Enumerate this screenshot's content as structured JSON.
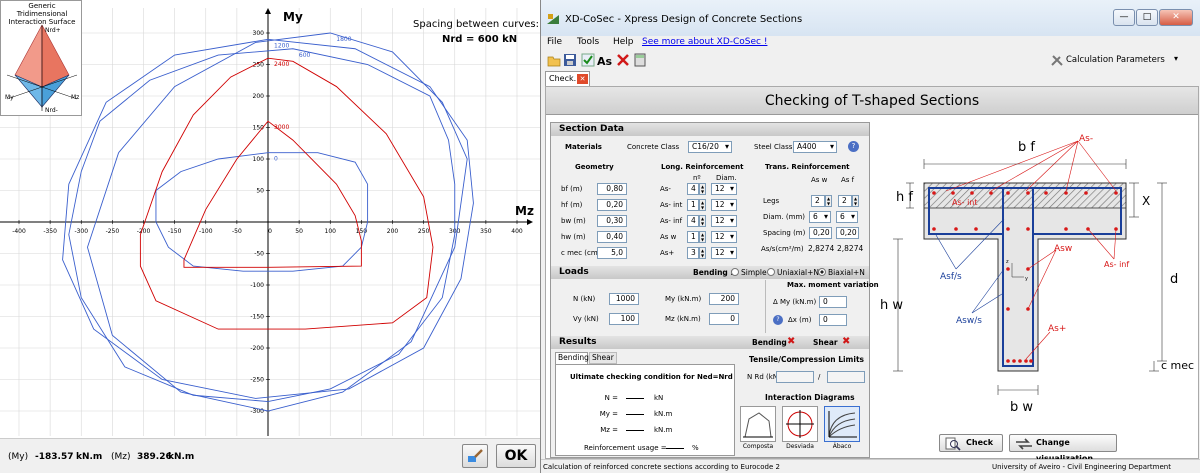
{
  "left_panel": {
    "thumbnail": {
      "title_line1": "Generic Tridimensional",
      "title_line2": "Interaction Surface",
      "top_label": "Nrd+",
      "bottom_label": "Nrd-",
      "my": "My",
      "mz": "Mz"
    },
    "spacing_label": "Spacing between curves:",
    "spacing_value": "Nrd = 600 kN",
    "chart_data": {
      "type": "line",
      "xlabel": "Mz",
      "ylabel": "My",
      "xlim": [
        -420,
        420
      ],
      "ylim": [
        -330,
        320
      ],
      "x_ticks": [
        -400,
        -350,
        -300,
        -250,
        -200,
        -150,
        -100,
        -50,
        0,
        50,
        100,
        150,
        200,
        250,
        300,
        350,
        400
      ],
      "y_ticks": [
        300,
        250,
        200,
        150,
        100,
        50,
        -50,
        -100,
        -150,
        -200,
        -250,
        -300
      ],
      "series": [
        {
          "name": "0",
          "color": "#3a5fcd",
          "points": [
            [
              -180,
              50
            ],
            [
              -140,
              80
            ],
            [
              -80,
              100
            ],
            [
              0,
              110
            ],
            [
              80,
              110
            ],
            [
              140,
              95
            ],
            [
              160,
              60
            ],
            [
              160,
              0
            ],
            [
              150,
              -40
            ],
            [
              120,
              -70
            ],
            [
              40,
              -78
            ],
            [
              -40,
              -78
            ],
            [
              -120,
              -70
            ],
            [
              -160,
              -40
            ],
            [
              -180,
              0
            ],
            [
              -180,
              50
            ]
          ]
        },
        {
          "name": "600",
          "color": "#3a5fcd",
          "points": [
            [
              -300,
              80
            ],
            [
              -270,
              160
            ],
            [
              -190,
              225
            ],
            [
              -80,
              265
            ],
            [
              40,
              275
            ],
            [
              160,
              250
            ],
            [
              260,
              200
            ],
            [
              290,
              130
            ],
            [
              300,
              60
            ],
            [
              300,
              -20
            ],
            [
              280,
              -120
            ],
            [
              210,
              -210
            ],
            [
              100,
              -265
            ],
            [
              0,
              -285
            ],
            [
              -120,
              -275
            ],
            [
              -230,
              -230
            ],
            [
              -300,
              -120
            ],
            [
              -320,
              -20
            ],
            [
              -300,
              80
            ]
          ]
        },
        {
          "name": "1200",
          "color": "#3a5fcd",
          "points": [
            [
              -320,
              60
            ],
            [
              -260,
              190
            ],
            [
              -150,
              265
            ],
            [
              0,
              290
            ],
            [
              140,
              275
            ],
            [
              260,
              215
            ],
            [
              320,
              130
            ],
            [
              330,
              30
            ],
            [
              310,
              -90
            ],
            [
              250,
              -200
            ],
            [
              130,
              -265
            ],
            [
              -20,
              -280
            ],
            [
              -170,
              -250
            ],
            [
              -280,
              -170
            ],
            [
              -330,
              -60
            ],
            [
              -320,
              60
            ]
          ]
        },
        {
          "name": "1800",
          "color": "#3a5fcd",
          "points": [
            [
              -240,
              110
            ],
            [
              -150,
              215
            ],
            [
              -20,
              285
            ],
            [
              100,
              300
            ],
            [
              200,
              270
            ],
            [
              280,
              190
            ],
            [
              320,
              100
            ],
            [
              300,
              -40
            ],
            [
              230,
              -190
            ],
            [
              120,
              -270
            ],
            [
              0,
              -300
            ],
            [
              -140,
              -270
            ],
            [
              -250,
              -180
            ],
            [
              -290,
              -40
            ],
            [
              -240,
              110
            ]
          ]
        },
        {
          "name": "2400",
          "color": "#d00000",
          "points": [
            [
              -205,
              -20
            ],
            [
              -170,
              80
            ],
            [
              -120,
              170
            ],
            [
              -60,
              230
            ],
            [
              0,
              260
            ],
            [
              40,
              255
            ],
            [
              110,
              215
            ],
            [
              190,
              140
            ],
            [
              250,
              40
            ],
            [
              265,
              -40
            ],
            [
              255,
              -120
            ],
            [
              200,
              -160
            ],
            [
              60,
              -170
            ],
            [
              -80,
              -170
            ],
            [
              -180,
              -125
            ],
            [
              -205,
              -70
            ],
            [
              -205,
              -20
            ]
          ]
        },
        {
          "name": "3000",
          "color": "#d00000",
          "points": [
            [
              -135,
              -60
            ],
            [
              -100,
              20
            ],
            [
              -50,
              100
            ],
            [
              0,
              160
            ],
            [
              40,
              130
            ],
            [
              110,
              60
            ],
            [
              140,
              10
            ],
            [
              150,
              -30
            ],
            [
              150,
              -70
            ],
            [
              0,
              -72
            ],
            [
              -135,
              -72
            ],
            [
              -135,
              -60
            ]
          ]
        }
      ]
    },
    "status": {
      "my_label": "(My)",
      "my_value": "-183.57",
      "my_unit": "kN.m",
      "mz_label": "(Mz)",
      "mz_value": "389.26",
      "mz_unit": "kN.m"
    },
    "ok_label": "OK"
  },
  "window": {
    "title": "XD-CoSec  -  Xpress Design of Concrete Sections",
    "menu": {
      "file": "File",
      "tools": "Tools",
      "help": "Help",
      "link": "See more about XD-CoSec !"
    },
    "calc_params": "Calculation Parameters",
    "tab": "Check.",
    "heading": "Checking of T-shaped Sections",
    "section_data": {
      "header": "Section Data",
      "materials": "Materials",
      "concrete_label": "Concrete Class",
      "concrete_value": "C16/20",
      "steel_label": "Steel Class",
      "steel_value": "A400",
      "geometry": "Geometry",
      "long_reinf": "Long. Reinforcement",
      "trans_reinf": "Trans. Reinforcement",
      "n_col": "nº",
      "diam_col": "Diam.",
      "asw_col": "As w",
      "asf_col": "As f",
      "geom": [
        {
          "label": "bf (m)",
          "value": "0,80"
        },
        {
          "label": "hf (m)",
          "value": "0,20"
        },
        {
          "label": "bw (m)",
          "value": "0,30"
        },
        {
          "label": "hw (m)",
          "value": "0,40"
        },
        {
          "label": "c mec (cm)",
          "value": "5,0"
        }
      ],
      "long": [
        {
          "label": "As-",
          "n": "4",
          "d": "12"
        },
        {
          "label": "As- int",
          "n": "1",
          "d": "12"
        },
        {
          "label": "As- inf",
          "n": "4",
          "d": "12"
        },
        {
          "label": "As w",
          "n": "1",
          "d": "12"
        },
        {
          "label": "As+",
          "n": "3",
          "d": "12"
        }
      ],
      "legs_label": "Legs",
      "legs_w": "2",
      "legs_f": "2",
      "diam_label": "Diam. (mm)",
      "diam_w": "6",
      "diam_f": "6",
      "spacing_label": "Spacing (m)",
      "spacing_w": "0,20",
      "spacing_f": "0,20",
      "ratio_label": "As/s(cm²/m)",
      "ratio_w": "2,8274",
      "ratio_f": "2,8274"
    },
    "loads": {
      "header": "Loads",
      "bending_label": "Bending :",
      "opt_simple": "Simple",
      "opt_uniaxial": "Uniaxial+N",
      "opt_biaxial": "Biaxial+N",
      "n_label": "N (kN)",
      "n_value": "1000",
      "my_label": "My (kN.m)",
      "my_value": "200",
      "vy_label": "Vy (kN)",
      "vy_value": "100",
      "mz_label": "Mz (kN.m)",
      "mz_value": "0",
      "max_var": "Max. moment variation",
      "dm_label": "Δ My (kN.m)",
      "dm_value": "0",
      "dx_label": "Δx (m)",
      "dx_value": "0"
    },
    "results": {
      "header": "Results",
      "bending": "Bending",
      "shear": "Shear",
      "tab_bending": "Bending",
      "tab_shear": "Shear",
      "ult_title": "Ultimate checking condition for Ned=Nrd",
      "rows": [
        {
          "label": "N =",
          "unit": "kN"
        },
        {
          "label": "My =",
          "unit": "kN.m"
        },
        {
          "label": "Mz =",
          "unit": "kN.m"
        }
      ],
      "usage_label": "Reinforcement usage =",
      "usage_unit": "%",
      "tc_title": "Tensile/Compression Limits",
      "nrd_label": "N Rd (kN)",
      "slash": "/",
      "id_title": "Interaction Diagrams",
      "diagrams": [
        "Composta",
        "Desviada",
        "Ábaco"
      ]
    },
    "drawing": {
      "bf": "b f",
      "hf": "h f",
      "hw": "h w",
      "bw": "b w",
      "d": "d",
      "x": "X",
      "cmec": "c mec",
      "as_minus": "As-",
      "as_int": "As- int",
      "as_inf": "As- inf",
      "asf_s": "Asf/s",
      "asw": "Asw",
      "asw_s": "Asw/s",
      "as_plus": "As+",
      "axis_y": "y",
      "axis_z": "z"
    },
    "check_btn": "Check",
    "change_btn": "Change visualization",
    "status_left": "Calculation of reinforced concrete sections according to Eurocode 2",
    "status_right": "University of Aveiro - Civil Engineering Department"
  }
}
